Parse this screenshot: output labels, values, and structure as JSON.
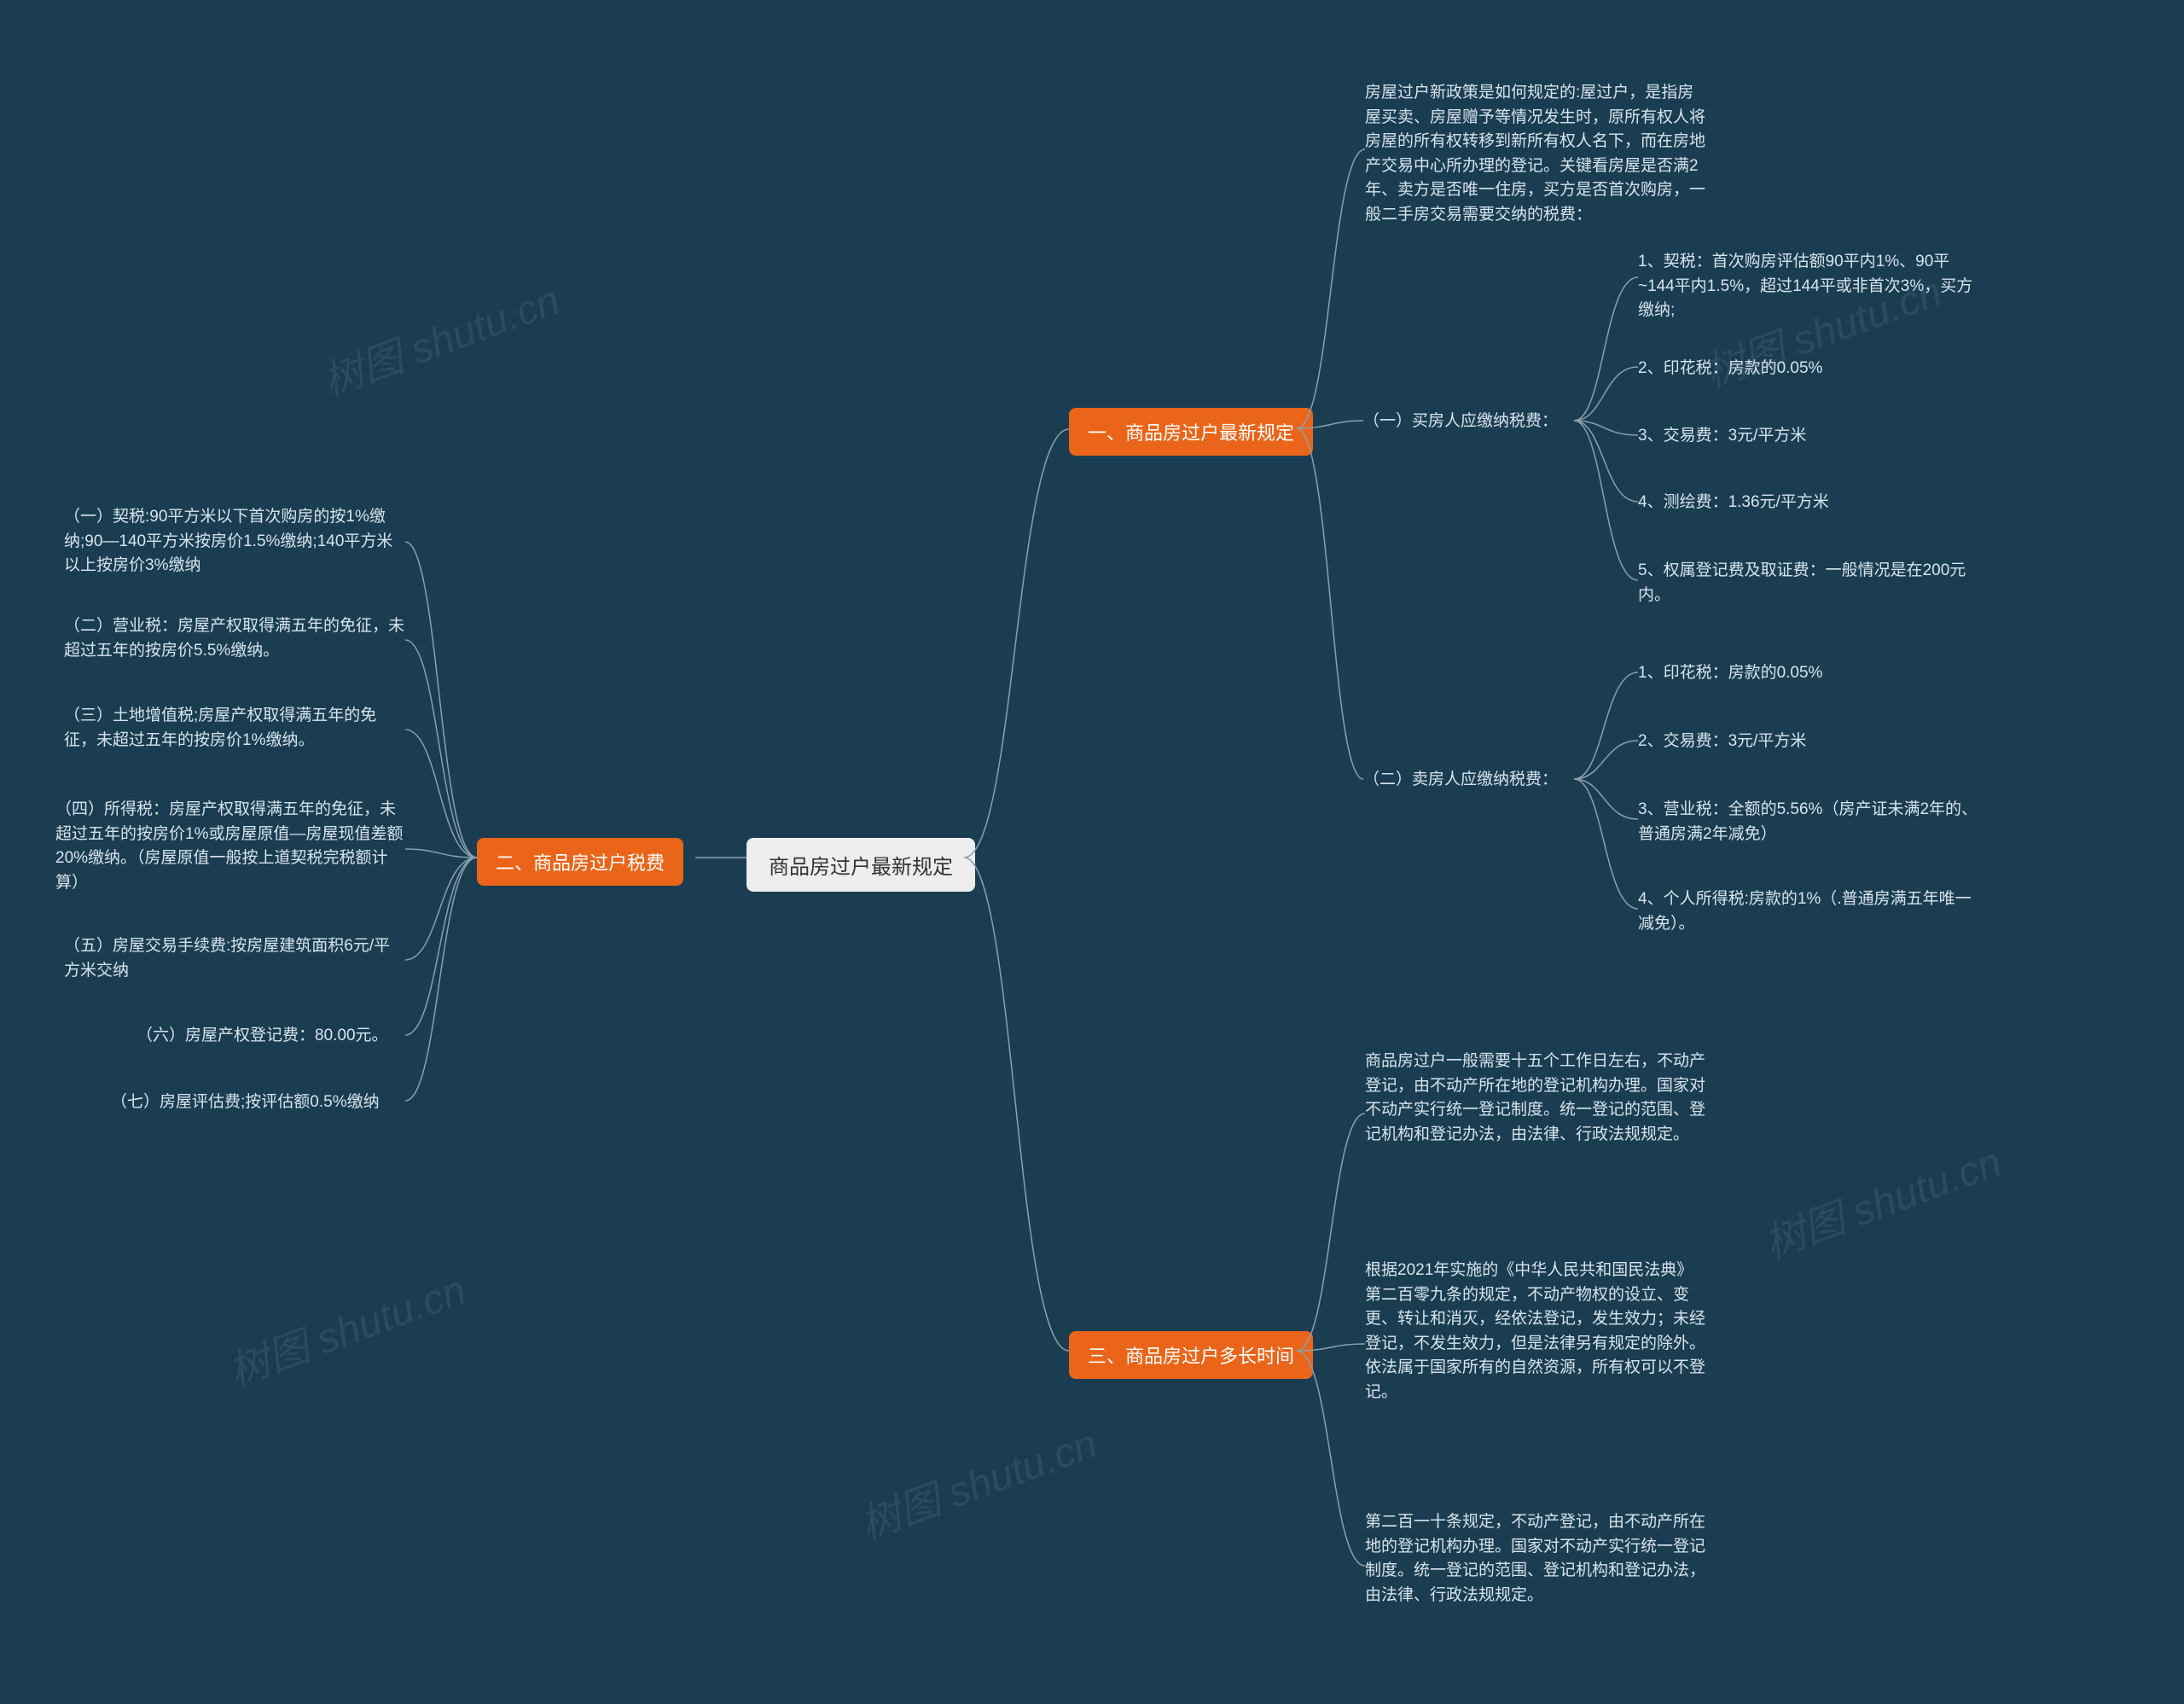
{
  "watermark": "树图 shutu.cn",
  "root": {
    "label": "商品房过户最新规定"
  },
  "branch1": {
    "label": "一、商品房过户最新规定",
    "intro": "房屋过户新政策是如何规定的:屋过户，是指房屋买卖、房屋赠予等情况发生时，原所有权人将房屋的所有权转移到新所有权人名下，而在房地产交易中心所办理的登记。关键看房屋是否满2年、卖方是否唯一住房，买方是否首次购房，一般二手房交易需要交纳的税费：",
    "buyer_title": "（一）买房人应缴纳税费：",
    "buyer_items": {
      "i1": "1、契税：首次购房评估额90平内1%、90平~144平内1.5%，超过144平或非首次3%，买方缴纳;",
      "i2": "2、印花税：房款的0.05%",
      "i3": "3、交易费：3元/平方米",
      "i4": "4、测绘费：1.36元/平方米",
      "i5": "5、权属登记费及取证费：一般情况是在200元内。"
    },
    "seller_title": "（二）卖房人应缴纳税费：",
    "seller_items": {
      "i1": "1、印花税：房款的0.05%",
      "i2": "2、交易费：3元/平方米",
      "i3": "3、营业税：全额的5.56%（房产证未满2年的、普通房满2年减免）",
      "i4": "4、个人所得税:房款的1%（.普通房满五年唯一减免）。"
    }
  },
  "branch2": {
    "label": "二、商品房过户税费",
    "items": {
      "i1": "（一）契税:90平方米以下首次购房的按1%缴纳;90—140平方米按房价1.5%缴纳;140平方米以上按房价3%缴纳",
      "i2": "（二）营业税：房屋产权取得满五年的免征，未超过五年的按房价5.5%缴纳。",
      "i3": "（三）土地增值税;房屋产权取得满五年的免征，未超过五年的按房价1%缴纳。",
      "i4": "（四）所得税：房屋产权取得满五年的免征，未超过五年的按房价1%或房屋原值—房屋现值差额20%缴纳。（房屋原值一般按上道契税完税额计算）",
      "i5": "（五）房屋交易手续费:按房屋建筑面积6元/平方米交纳",
      "i6": "（六）房屋产权登记费：80.00元。",
      "i7": "（七）房屋评估费;按评估额0.5%缴纳"
    }
  },
  "branch3": {
    "label": "三、商品房过户多长时间",
    "items": {
      "i1": "商品房过户一般需要十五个工作日左右，不动产登记，由不动产所在地的登记机构办理。国家对不动产实行统一登记制度。统一登记的范围、登记机构和登记办法，由法律、行政法规规定。",
      "i2": "根据2021年实施的《中华人民共和国民法典》第二百零九条的规定，不动产物权的设立、变更、转让和消灭，经依法登记，发生效力；未经登记，不发生效力，但是法律另有规定的除外。依法属于国家所有的自然资源，所有权可以不登记。",
      "i3": "第二百一十条规定，不动产登记，由不动产所在地的登记机构办理。国家对不动产实行统一登记制度。统一登记的范围、登记机构和登记办法，由法律、行政法规规定。"
    }
  }
}
